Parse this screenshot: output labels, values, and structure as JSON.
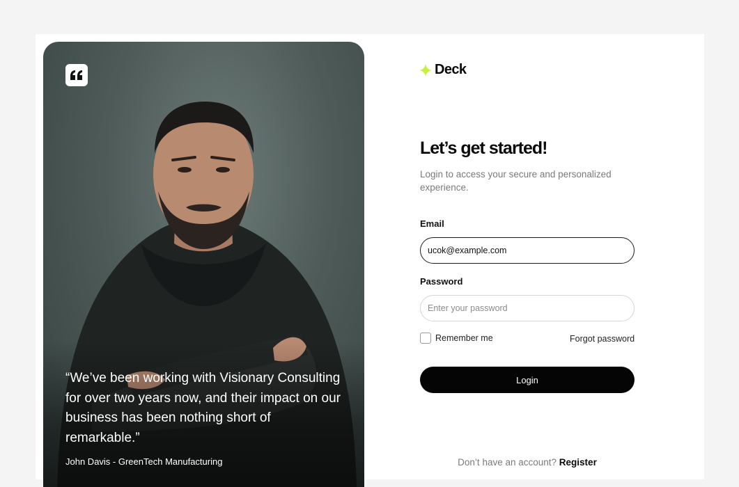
{
  "brand": {
    "name": "Deck",
    "accent_color": "#c8f23a",
    "logo_icon": "sparkle-icon"
  },
  "testimonial": {
    "icon": "quote-icon",
    "quote": "“We’ve been working with Visionary Consulting for over two years now, and their impact on our business has been nothing short of remarkable.”",
    "author": "John Davis - GreenTech Manufacturing"
  },
  "form": {
    "title": "Let’s get started!",
    "subtitle": "Login to access your secure and personalized experience.",
    "email": {
      "label": "Email",
      "value": "ucok@example.com"
    },
    "password": {
      "label": "Password",
      "placeholder": "Enter your password"
    },
    "remember_label": "Remember me",
    "forgot_label": "Forgot password",
    "login_label": "Login",
    "register_prompt": "Don’t have an account?",
    "register_label": "Register"
  }
}
